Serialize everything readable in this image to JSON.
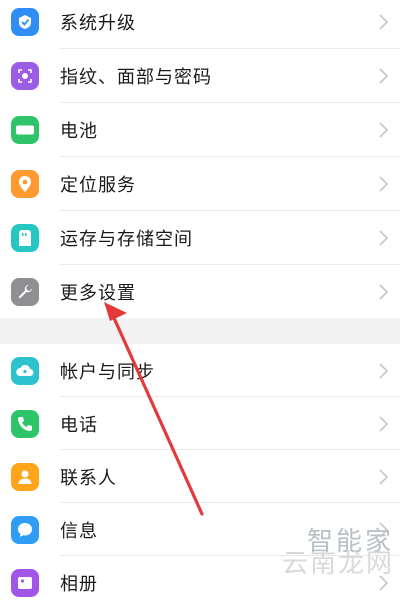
{
  "settings": {
    "group1": [
      {
        "label": "系统升级",
        "icon": "system-update-icon",
        "color": "#2f8ef5"
      },
      {
        "label": "指纹、面部与密码",
        "icon": "fingerprint-face-icon",
        "color": "#9b5de5"
      },
      {
        "label": "电池",
        "icon": "battery-icon",
        "color": "#2fc46a"
      },
      {
        "label": "定位服务",
        "icon": "location-icon",
        "color": "#ff9a2e"
      },
      {
        "label": "运存与存储空间",
        "icon": "storage-icon",
        "color": "#26c6c2"
      },
      {
        "label": "更多设置",
        "icon": "wrench-icon",
        "color": "#8e8e93"
      }
    ],
    "group2": [
      {
        "label": "帐户与同步",
        "icon": "cloud-account-icon",
        "color": "#2cc3cf"
      },
      {
        "label": "电话",
        "icon": "phone-icon",
        "color": "#2fc46a"
      },
      {
        "label": "联系人",
        "icon": "contacts-icon",
        "color": "#ffa41b"
      },
      {
        "label": "信息",
        "icon": "message-icon",
        "color": "#2f9cf5"
      },
      {
        "label": "相册",
        "icon": "album-icon",
        "color": "#a256e8"
      }
    ]
  },
  "annotation": {
    "arrow_color": "#e23b3b"
  },
  "watermark": {
    "line1": "智能家",
    "line2": "云南龙网"
  }
}
